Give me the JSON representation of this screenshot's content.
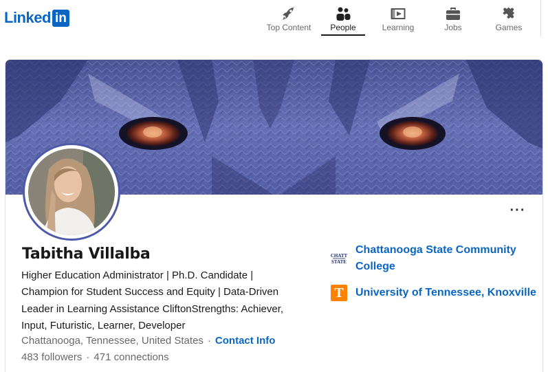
{
  "brand": {
    "logo_text": "Linked",
    "logo_box": "in"
  },
  "nav": {
    "items": [
      {
        "label": "Top Content",
        "icon": "rocket-icon",
        "active": false
      },
      {
        "label": "People",
        "icon": "people-icon",
        "active": true
      },
      {
        "label": "Learning",
        "icon": "video-icon",
        "active": false
      },
      {
        "label": "Jobs",
        "icon": "briefcase-icon",
        "active": false
      },
      {
        "label": "Games",
        "icon": "puzzle-icon",
        "active": false
      }
    ]
  },
  "profile": {
    "name": "Tabitha Villalba",
    "headline_lines": [
      "Higher Education Administrator | Ph.D. Candidate |",
      "Champion for Student Success and Equity | Data-Driven",
      "Leader in Learning Assistance CliftonStrengths: Achiever,",
      "Input, Futuristic, Learner, Developer"
    ],
    "location": "Chattanooga, Tennessee, United States",
    "separator": "·",
    "contact_info": "Contact Info",
    "followers": "483 followers",
    "connections": "471 connections",
    "more_label": "···"
  },
  "education": [
    {
      "name_lines": [
        "Chattanooga State Community",
        "College"
      ],
      "logo_text": "CHATT STATE",
      "icon": "chattanooga-state-logo"
    },
    {
      "name_lines": [
        "University of Tennessee, Knoxville"
      ],
      "logo_text": "T",
      "icon": "ut-knoxville-logo"
    }
  ],
  "colors": {
    "brand_blue": "#0a66c2",
    "banner_base": "#5a64a8",
    "avatar_ring": "#4d5aa8",
    "ut_orange": "#ff8200"
  }
}
